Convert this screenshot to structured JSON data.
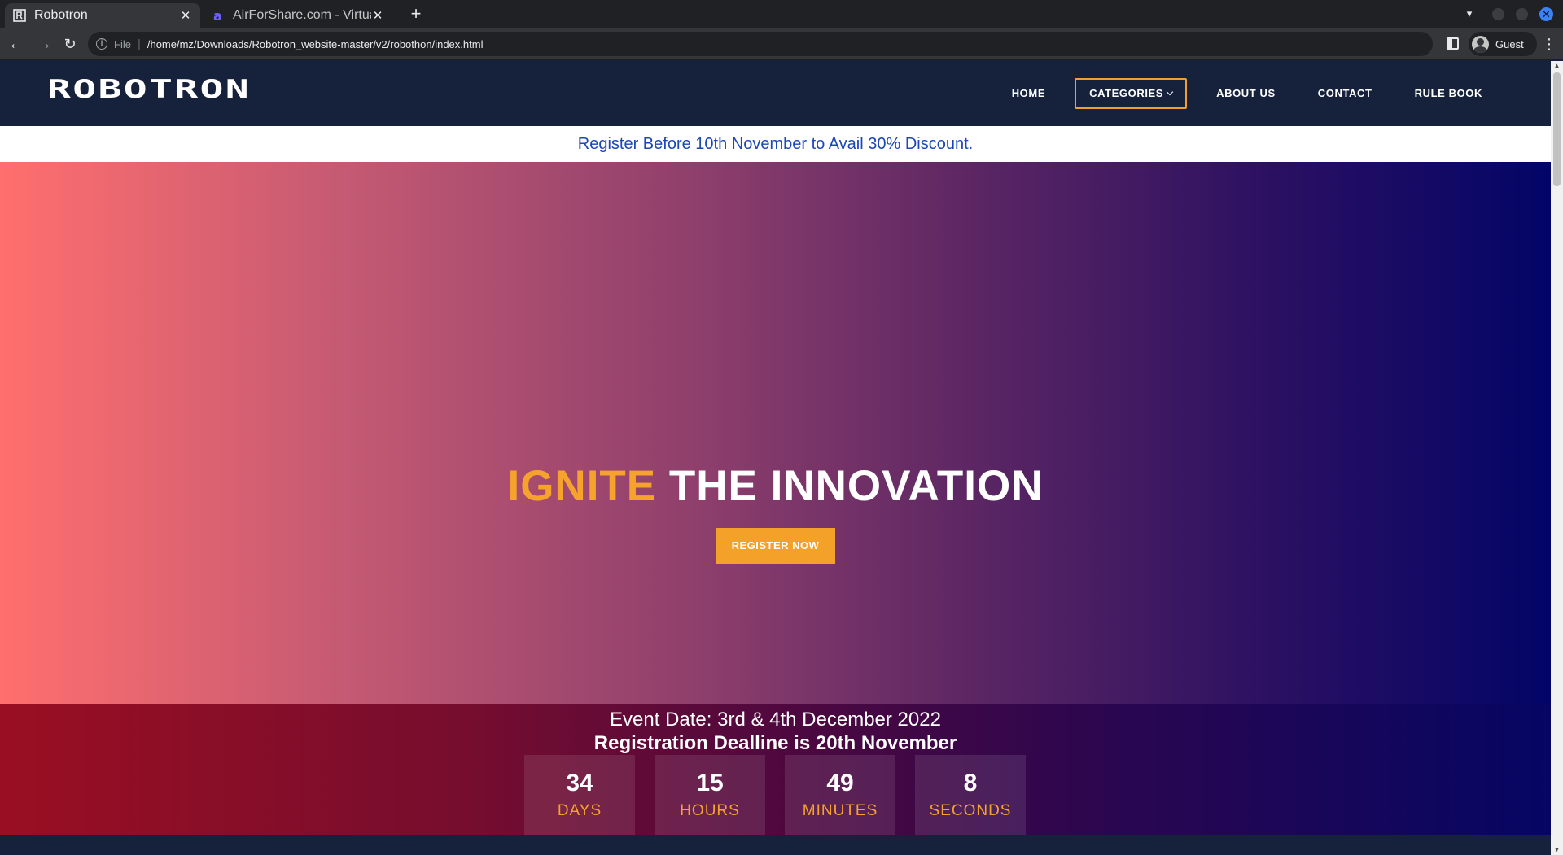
{
  "browser": {
    "tabs": [
      {
        "title": "Robotron",
        "active": true
      },
      {
        "title": "AirForShare.com - Virtual",
        "active": false
      }
    ],
    "address": {
      "scheme": "File",
      "url": "/home/mz/Downloads/Robotron_website-master/v2/robothon/index.html"
    },
    "profile": "Guest",
    "colors": {
      "tabbar": "#202124",
      "toolbar": "#35363a",
      "close_button": "#3b82f6"
    }
  },
  "site": {
    "logo_text": "ROBOTRON",
    "menu": [
      {
        "label": "HOME",
        "active": false,
        "dropdown": false
      },
      {
        "label": "CATEGORIES",
        "active": true,
        "dropdown": true
      },
      {
        "label": "ABOUT US",
        "active": false,
        "dropdown": false
      },
      {
        "label": "CONTACT",
        "active": false,
        "dropdown": false
      },
      {
        "label": "RULE BOOK",
        "active": false,
        "dropdown": false
      }
    ],
    "promo": "Register Before 10th November to Avail 30% Discount.",
    "hero": {
      "title_highlight": "IGNITE",
      "title_rest": "THE INNOVATION",
      "cta": "REGISTER NOW"
    },
    "event": {
      "date": "Event Date: 3rd & 4th December 2022",
      "deadline": "Registration Dealline is 20th November"
    },
    "countdown": [
      {
        "value": "34",
        "label": "DAYS"
      },
      {
        "value": "15",
        "label": "HOURS"
      },
      {
        "value": "49",
        "label": "MINUTES"
      },
      {
        "value": "8",
        "label": "SECONDS"
      }
    ],
    "colors": {
      "header_bg": "#16223b",
      "accent": "#f5a32c",
      "promo_text": "#1c47b8"
    }
  }
}
